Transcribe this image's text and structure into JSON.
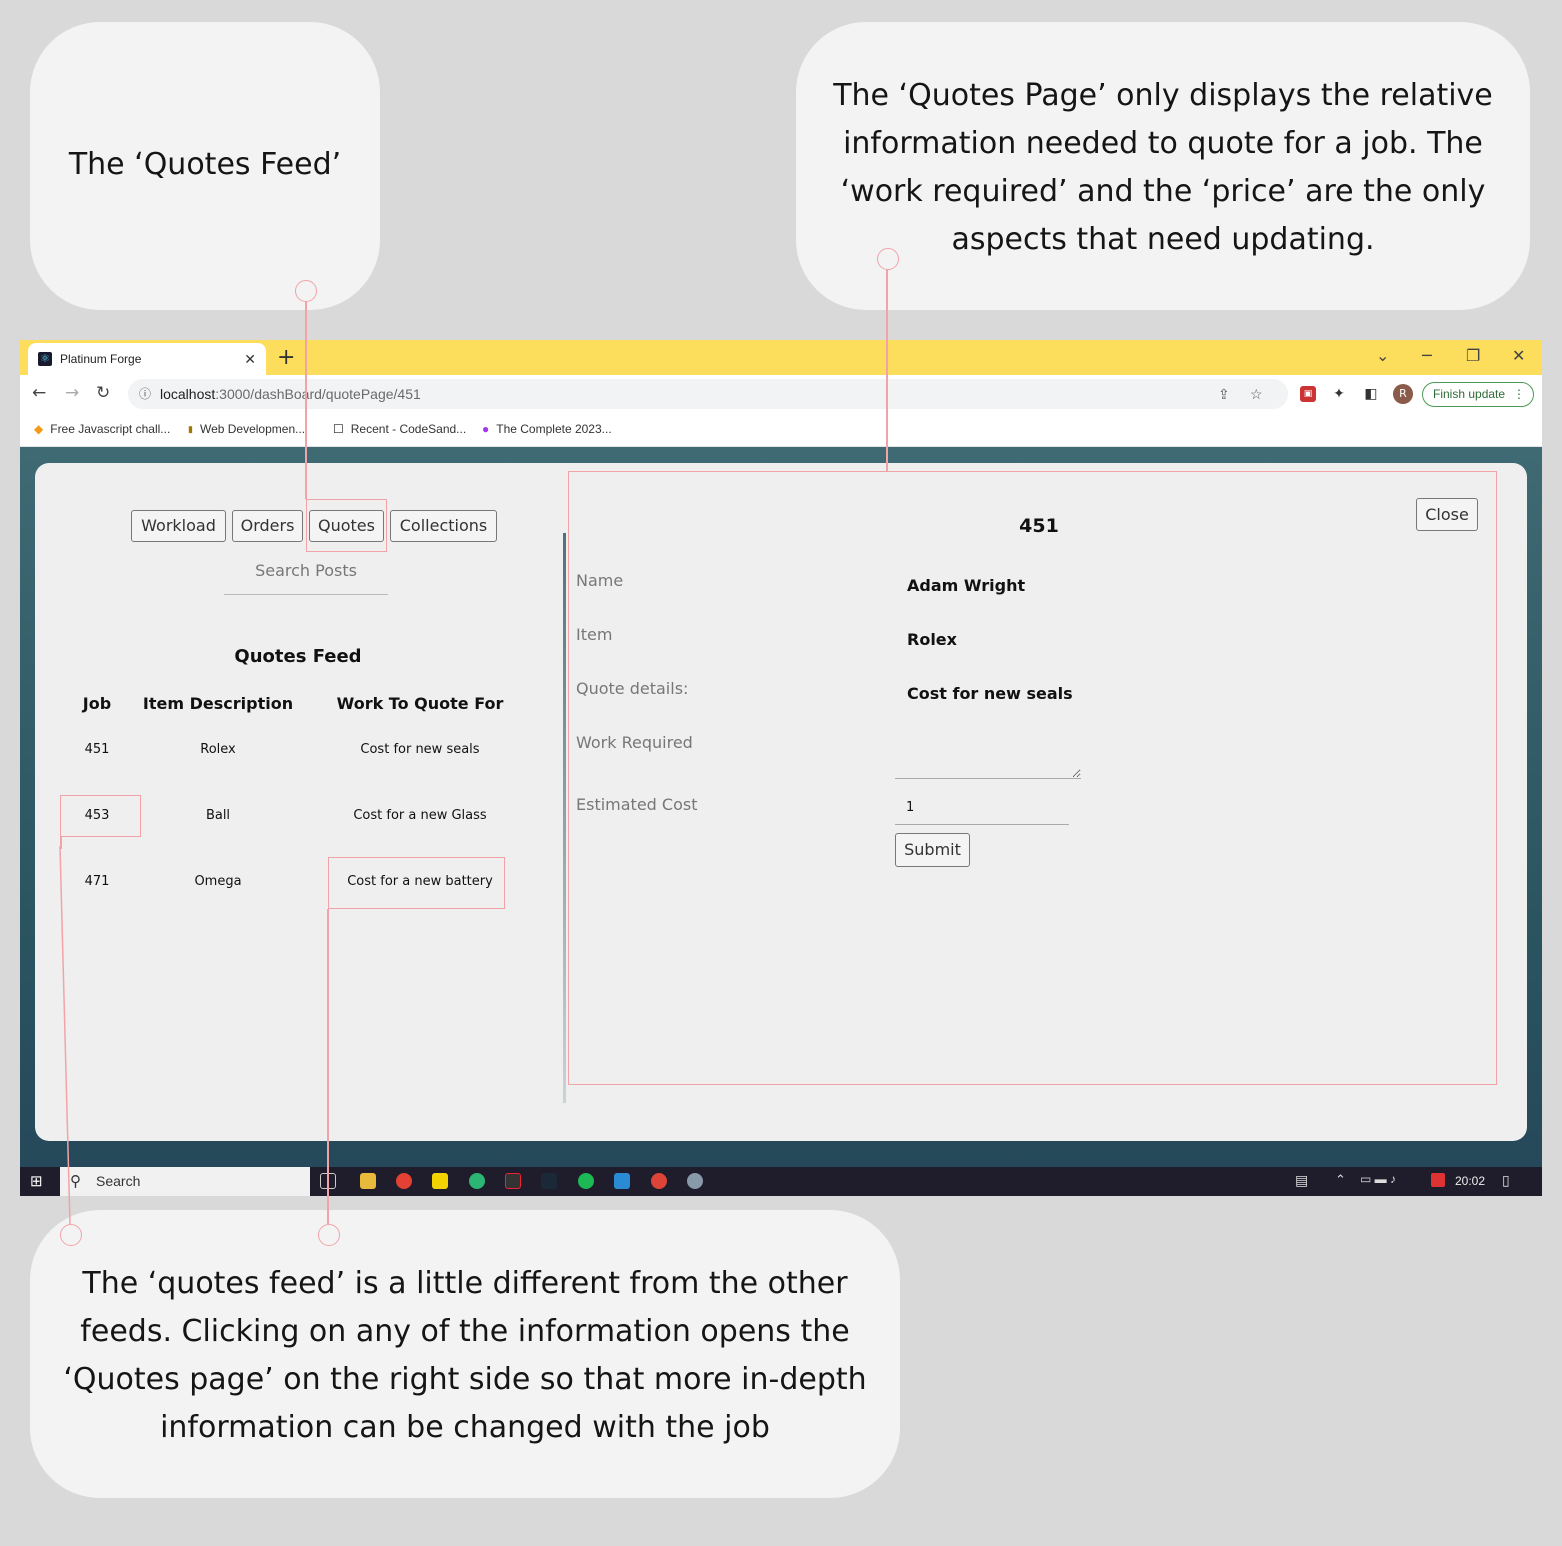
{
  "annotations": {
    "quotes_feed_label": "The ‘Quotes Feed’",
    "quotes_page_note": "The ‘Quotes Page’ only displays the relative information needed to quote for a job. The ‘work required’ and the ‘price’ are the only aspects that need updating.",
    "feed_note": "The ‘quotes feed’ is a little different from the other feeds. Clicking on any of the information opens the ‘Quotes page’ on the right side so that more in-depth information can be changed with the job"
  },
  "browser": {
    "tab_title": "Platinum Forge",
    "url_host": "localhost",
    "url_path": ":3000/dashBoard/quotePage/451",
    "finish_update": "Finish update",
    "bookmarks": [
      "Free Javascript chall...",
      "Web Developmen...",
      "Recent - CodeSand...",
      "The Complete 2023..."
    ]
  },
  "nav": {
    "workload": "Workload",
    "orders": "Orders",
    "quotes": "Quotes",
    "collections": "Collections"
  },
  "search_label": "Search Posts",
  "feed": {
    "title": "Quotes Feed",
    "columns": [
      "Job",
      "Item Description",
      "Work To Quote For"
    ],
    "rows": [
      {
        "job": "451",
        "item": "Rolex",
        "work": "Cost for new seals"
      },
      {
        "job": "453",
        "item": "Ball",
        "work": "Cost for a new Glass"
      },
      {
        "job": "471",
        "item": "Omega",
        "work": "Cost for a new battery"
      }
    ]
  },
  "quote_page": {
    "job_number": "451",
    "close_label": "Close",
    "name_label": "Name",
    "name_value": "Adam Wright",
    "item_label": "Item",
    "item_value": "Rolex",
    "details_label": "Quote details:",
    "details_value": "Cost for new seals",
    "work_label": "Work Required",
    "cost_label": "Estimated Cost",
    "cost_value": "1",
    "submit_label": "Submit"
  },
  "taskbar": {
    "search": "Search",
    "time": "20:02"
  },
  "colors": {
    "tabbar": "#fcdd5c",
    "annotation": "#f2a3a8",
    "page_bg": "#2c5662"
  }
}
